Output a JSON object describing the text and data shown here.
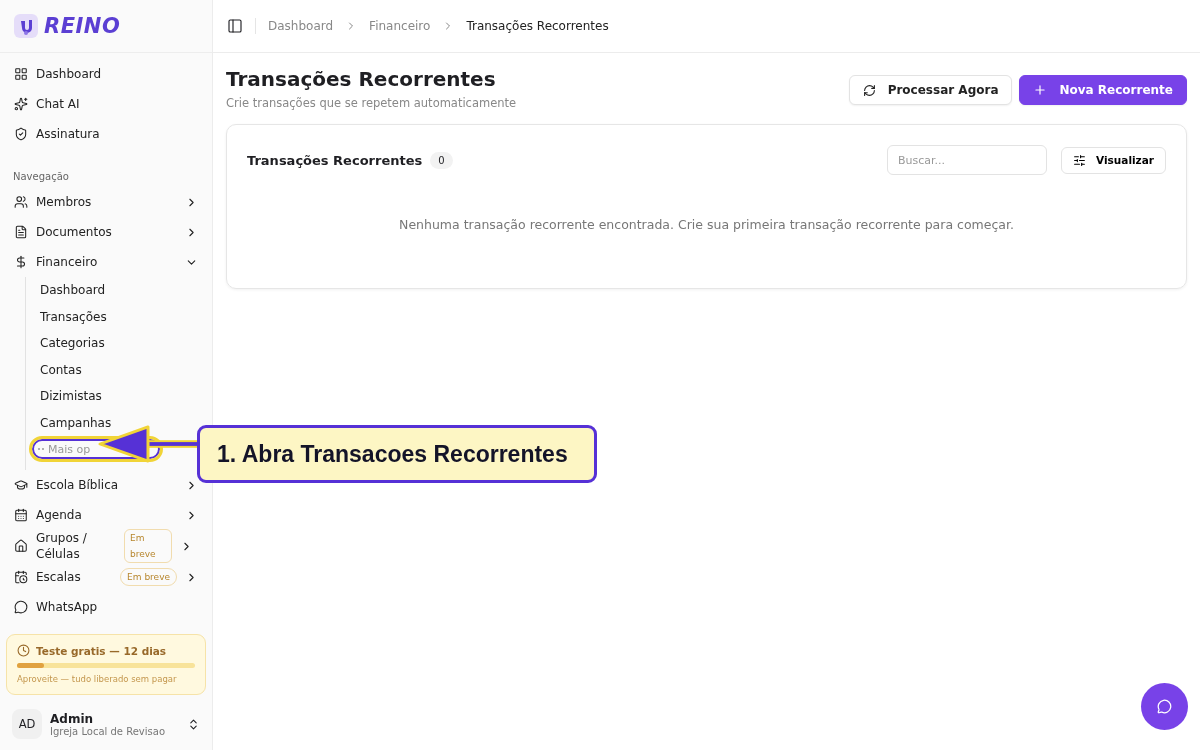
{
  "brand": {
    "name": "REINO"
  },
  "top_nav": [
    {
      "label": "Dashboard"
    },
    {
      "label": "Chat AI"
    },
    {
      "label": "Assinatura"
    }
  ],
  "nav_section": {
    "title": "Navegação"
  },
  "nav": [
    {
      "label": "Membros",
      "expanded": false
    },
    {
      "label": "Documentos",
      "expanded": false
    },
    {
      "label": "Financeiro",
      "expanded": true,
      "children": [
        {
          "label": "Dashboard",
          "kind": "link"
        },
        {
          "label": "Transações",
          "kind": "link"
        },
        {
          "label": "Categorias",
          "kind": "link"
        },
        {
          "label": "Contas",
          "kind": "link"
        },
        {
          "label": "Dizimistas",
          "kind": "link"
        },
        {
          "label": "Campanhas",
          "kind": "link"
        },
        {
          "label": "Mais op",
          "kind": "more"
        }
      ]
    },
    {
      "label": "Escola Bíblica",
      "expanded": false
    },
    {
      "label": "Agenda",
      "expanded": false
    },
    {
      "label": "Grupos / Células",
      "expanded": false,
      "badge": "Em breve"
    },
    {
      "label": "Escalas",
      "expanded": false,
      "badge": "Em breve"
    },
    {
      "label": "WhatsApp"
    }
  ],
  "trial": {
    "title": "Teste gratis — 12 dias",
    "level": 0.15,
    "note": "Aproveite — tudo liberado sem pagar"
  },
  "user": {
    "initials": "AD",
    "name": "Admin",
    "org": "Igreja Local de Revisao"
  },
  "breadcrumb": [
    {
      "label": "Dashboard",
      "current": false
    },
    {
      "label": "Financeiro",
      "current": false
    },
    {
      "label": "Transações Recorrentes",
      "current": true
    }
  ],
  "page": {
    "title": "Transações Recorrentes",
    "subtitle": "Crie transações que se repetem automaticamente",
    "buttons": [
      {
        "label": "Processar Agora",
        "kind": "secondary"
      },
      {
        "label": "Nova Recorrente",
        "kind": "primary"
      }
    ]
  },
  "card": {
    "title": "Transações Recorrentes",
    "count": "0",
    "search": {
      "placeholder": "Buscar..."
    },
    "view_button": "Visualizar",
    "empty_message": "Nenhuma transação recorrente encontrada. Crie sua primeira transação recorrente para começar."
  },
  "annotation": {
    "text": "1. Abra Transacoes Recorrentes"
  }
}
